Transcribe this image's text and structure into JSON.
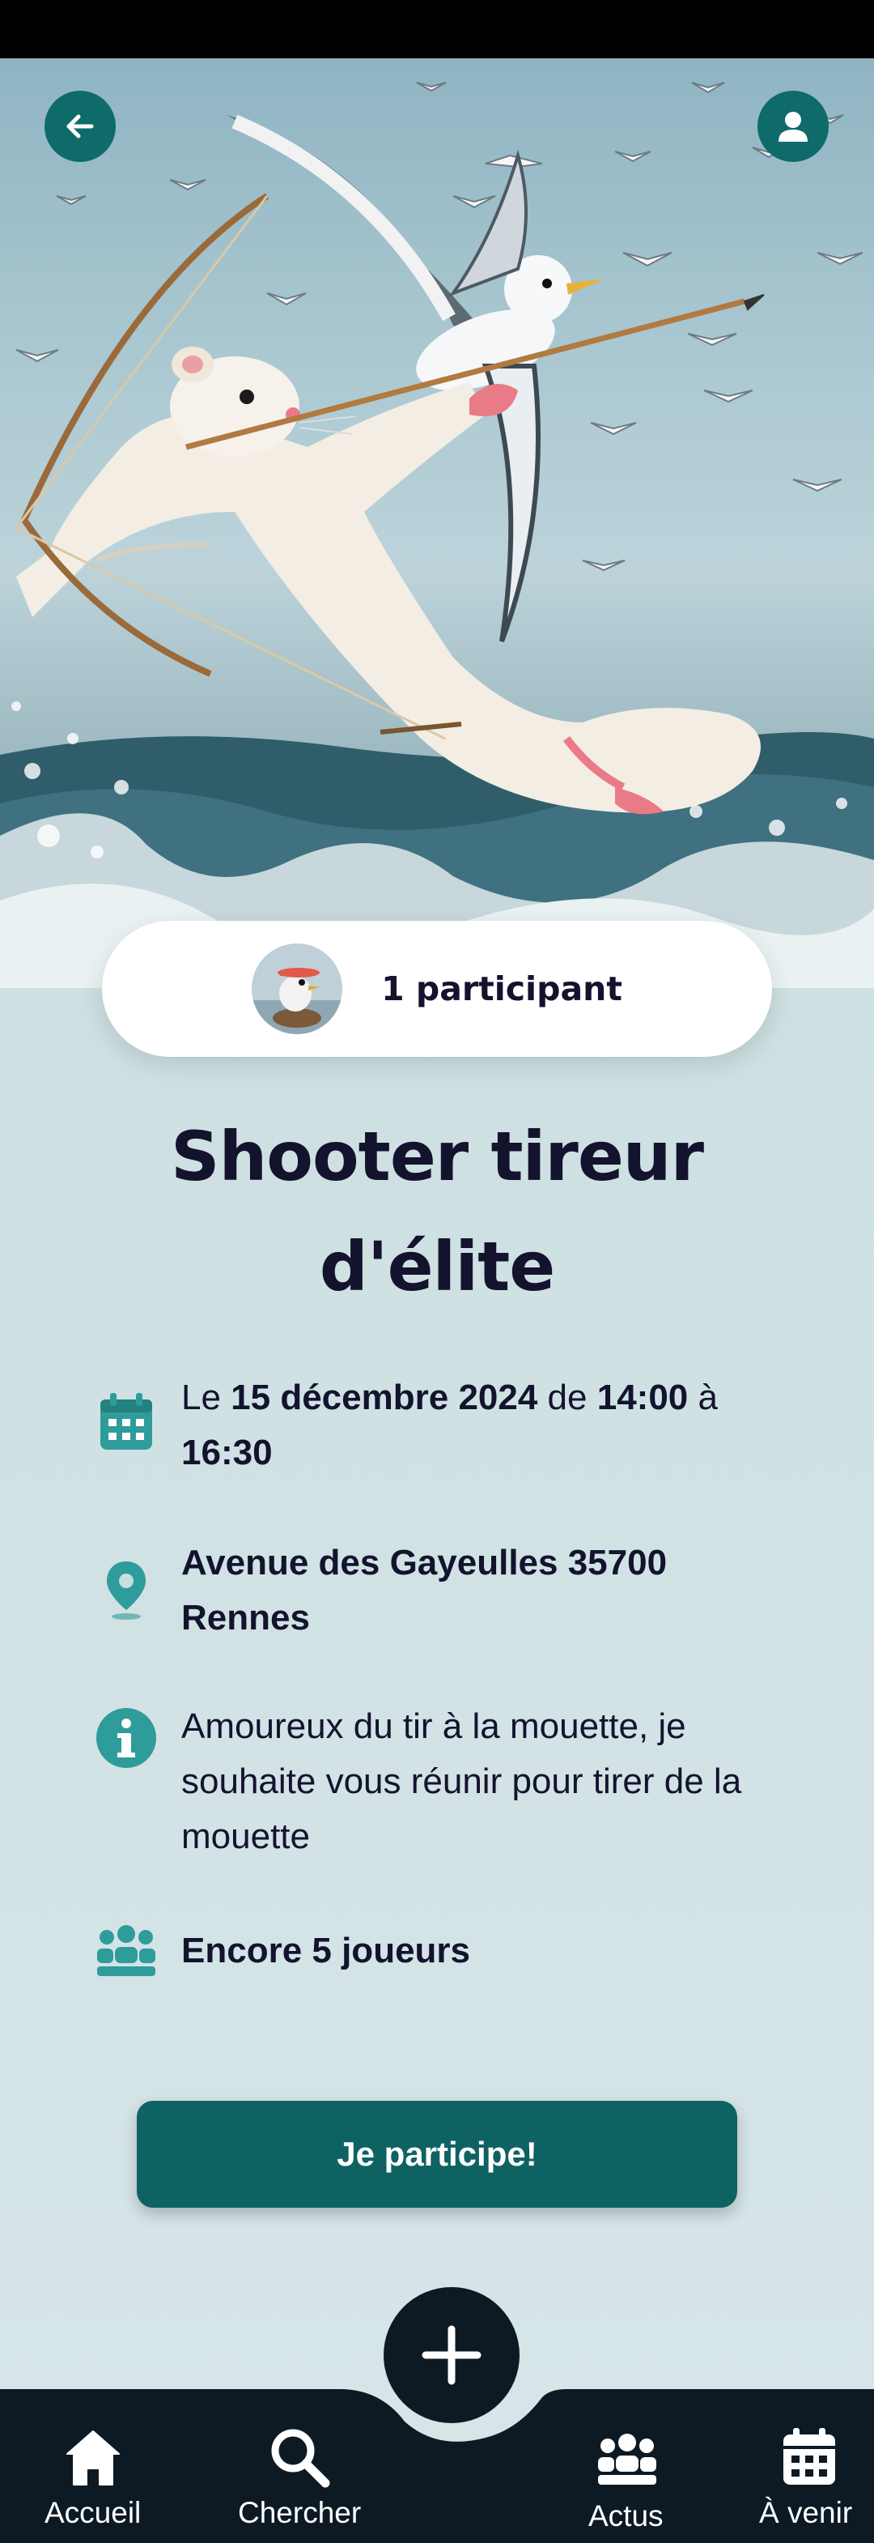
{
  "header": {
    "back_icon": "arrow-left-icon",
    "profile_icon": "user-icon"
  },
  "participants": {
    "label": "1 participant"
  },
  "event": {
    "title_line1": "Shooter tireur",
    "title_line2": "d'élite",
    "date": {
      "prefix": "Le ",
      "day": "15 décembre 2024",
      "mid": " de ",
      "start": "14:00",
      "end_prefix": " à ",
      "end": "16:30"
    },
    "address_line1": "Avenue des Gayeulles 35700",
    "address_line2": "Rennes",
    "description": "Amoureux du tir à la mouette, je souhaite vous réunir pour tirer de la mouette",
    "spots": "Encore 5 joueurs"
  },
  "cta": {
    "label": "Je participe!"
  },
  "nav": {
    "items": [
      {
        "label": "Accueil",
        "icon": "home-icon"
      },
      {
        "label": "Chercher",
        "icon": "search-icon"
      },
      {
        "label": "Actus",
        "icon": "users-icon"
      },
      {
        "label": "À venir",
        "icon": "calendar-icon"
      }
    ],
    "fab_icon": "plus-icon"
  },
  "colors": {
    "accent": "#0e6b6a",
    "nav_bg": "#0d1a24",
    "title": "#14132e",
    "icon_teal": "#2e9c9a"
  }
}
